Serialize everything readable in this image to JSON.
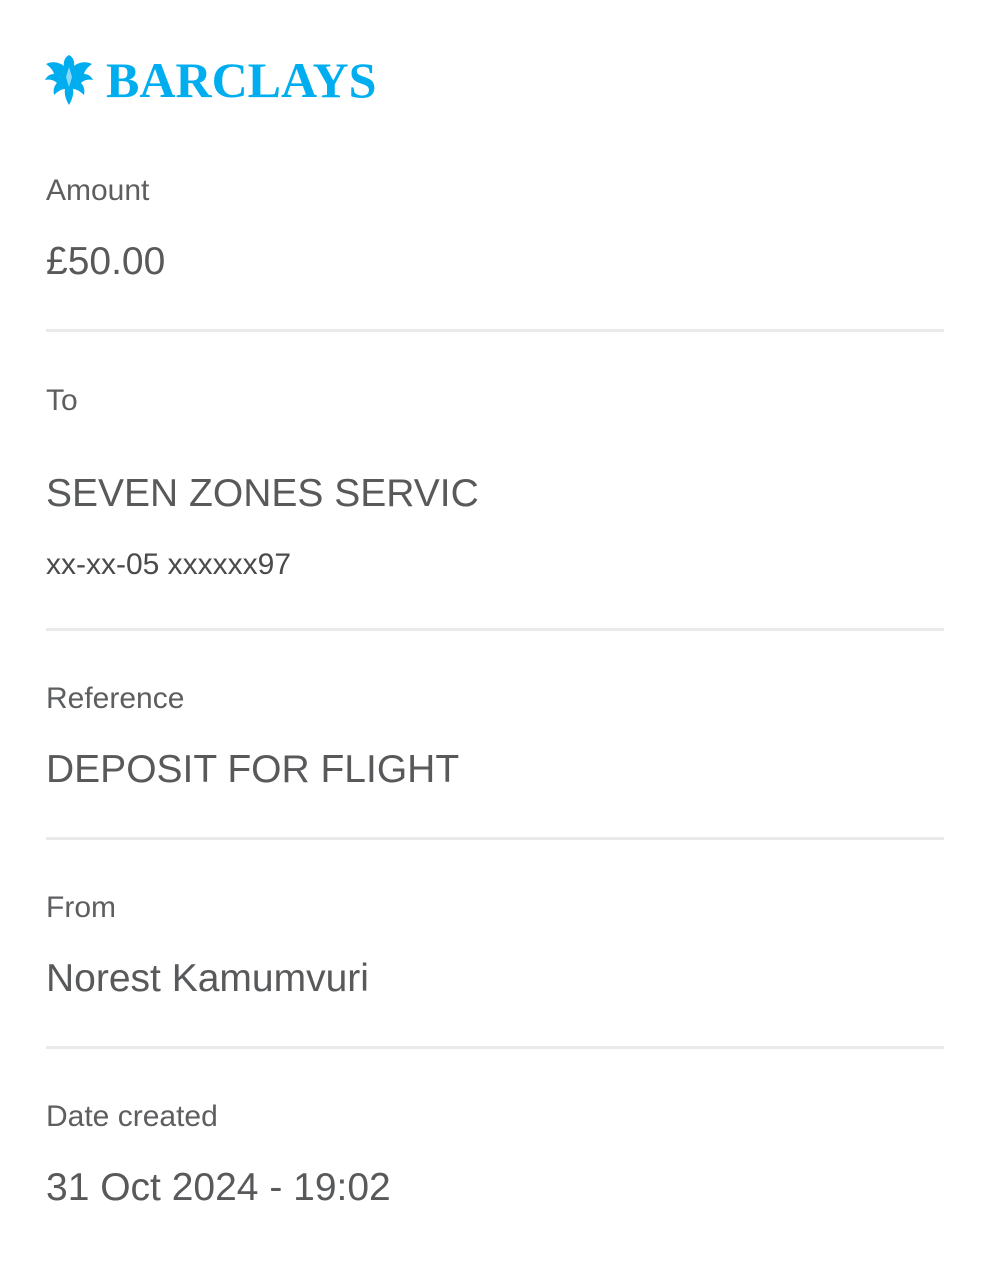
{
  "brand": {
    "name": "BARCLAYS",
    "color": "#00aeef",
    "icon": "eagle-icon"
  },
  "details": {
    "amount": {
      "label": "Amount",
      "value": "£50.00"
    },
    "to": {
      "label": "To",
      "name": "SEVEN ZONES SERVIC",
      "account": "xx-xx-05 xxxxxx97"
    },
    "reference": {
      "label": "Reference",
      "value": "DEPOSIT FOR FLIGHT"
    },
    "from": {
      "label": "From",
      "value": "Norest Kamumvuri"
    },
    "date_created": {
      "label": "Date created",
      "value": "31 Oct 2024 - 19:02"
    }
  }
}
